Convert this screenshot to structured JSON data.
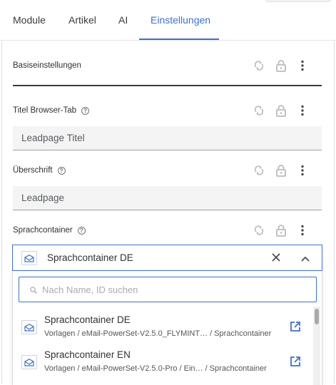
{
  "tabs": [
    {
      "label": "Module"
    },
    {
      "label": "Artikel"
    },
    {
      "label": "AI"
    },
    {
      "label": "Einstellungen",
      "active": true
    }
  ],
  "colors": {
    "accent": "#3a71d8",
    "text": "#2f3135",
    "muted_icon": "#b9bcc0",
    "dark_icon": "#5a5c61",
    "input_bg": "#f4f4f5"
  },
  "fields": {
    "basis": {
      "label": "Basiseinstellungen"
    },
    "titel": {
      "label": "Titel Browser-Tab",
      "value": "Leadpage Titel"
    },
    "ueberschrift": {
      "label": "Überschrift",
      "value": "Leadpage"
    },
    "sprach": {
      "label": "Sprachcontainer",
      "value": "Sprachcontainer DE"
    }
  },
  "dropdown": {
    "search_placeholder": "Nach Name, ID suchen",
    "options": [
      {
        "name": "Sprachcontainer DE",
        "path": "Vorlagen / eMail-PowerSet-V2.5.0_FLYMINT… / Sprachcontainer"
      },
      {
        "name": "Sprachcontainer EN",
        "path": "Vorlagen / eMail-PowerSet-V2.5.0-Pro / Ein… / Sprachcontainer"
      }
    ]
  },
  "icons": {
    "field_actions": [
      "sync-disabled-icon",
      "lock-icon",
      "more-vert-icon"
    ],
    "help": "help-circle-icon",
    "envelope": "envelope-icon",
    "clear": "close-icon",
    "collapse": "chevron-up-icon",
    "search": "search-icon",
    "open": "open-external-icon"
  }
}
